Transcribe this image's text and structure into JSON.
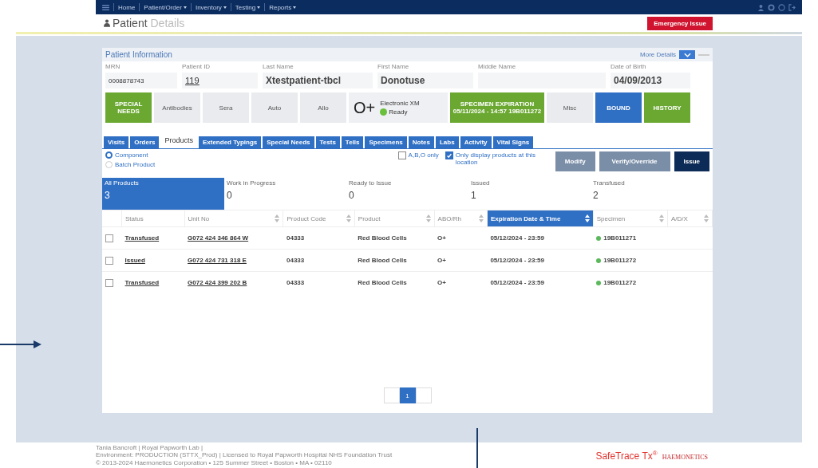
{
  "nav": {
    "items": [
      {
        "label": "Home",
        "dropdown": false
      },
      {
        "label": "Patient/Order",
        "dropdown": true
      },
      {
        "label": "Inventory",
        "dropdown": true
      },
      {
        "label": "Testing",
        "dropdown": true
      },
      {
        "label": "Reports",
        "dropdown": true
      }
    ]
  },
  "header": {
    "title_bold": "Patient",
    "title_light": "Details",
    "emergency_button": "Emergency Issue"
  },
  "patient": {
    "title": "Patient Information",
    "more_details": "More Details",
    "fields": [
      {
        "label": "MRN",
        "value": "0008878743",
        "kind": "text"
      },
      {
        "label": "Patient ID",
        "value": "119",
        "kind": "link"
      },
      {
        "label": "Last Name",
        "value": "Xtestpatient-tbcl",
        "kind": "big"
      },
      {
        "label": "First Name",
        "value": "Donotuse",
        "kind": "big"
      },
      {
        "label": "Middle Name",
        "kind": "empty"
      },
      {
        "label": "Date of Birth",
        "value": "04/09/2013",
        "kind": "big"
      }
    ],
    "buttons": [
      {
        "label": "SPECIAL NEEDS",
        "kind": "green"
      },
      {
        "label": "Antibodies",
        "kind": "grey"
      },
      {
        "label": "Sera",
        "kind": "grey"
      },
      {
        "label": "Auto",
        "kind": "grey"
      },
      {
        "label": "Allo",
        "kind": "grey"
      },
      {
        "label": "O+",
        "kind": "blood",
        "xm_label": "Electronic XM",
        "xm_status": "Ready"
      },
      {
        "label": "SPECIMEN EXPIRATION 05/11/2024 - 14:57 19B011272",
        "kind": "green"
      },
      {
        "label": "Misc",
        "kind": "grey"
      },
      {
        "label": "BOUND",
        "kind": "blue"
      },
      {
        "label": "HISTORY",
        "kind": "green"
      }
    ]
  },
  "tabs": [
    {
      "label": "Visits",
      "selected": false
    },
    {
      "label": "Orders",
      "selected": false
    },
    {
      "label": "Products",
      "selected": true
    },
    {
      "label": "Extended Typings",
      "selected": false
    },
    {
      "label": "Special Needs",
      "selected": false
    },
    {
      "label": "Tests",
      "selected": false
    },
    {
      "label": "Tells",
      "selected": false
    },
    {
      "label": "Specimens",
      "selected": false
    },
    {
      "label": "Notes",
      "selected": false
    },
    {
      "label": "Labs",
      "selected": false
    },
    {
      "label": "Activity",
      "selected": false
    },
    {
      "label": "Vital Signs",
      "selected": false
    }
  ],
  "product_type": [
    {
      "label": "Component",
      "selected": true
    },
    {
      "label": "Batch Product",
      "selected": false
    }
  ],
  "filters": [
    {
      "label": "A,B,O only",
      "checked": false
    },
    {
      "label": "Only display products at this location",
      "checked": true
    }
  ],
  "actions": [
    {
      "label": "Modify",
      "kind": "grey"
    },
    {
      "label": "Verify/Override",
      "kind": "grey"
    },
    {
      "label": "Issue",
      "kind": "dark"
    }
  ],
  "summary": [
    {
      "label": "All Products",
      "count": "3",
      "selected": true
    },
    {
      "label": "Work in Progress",
      "count": "0",
      "selected": false
    },
    {
      "label": "Ready to Issue",
      "count": "0",
      "selected": false
    },
    {
      "label": "Issued",
      "count": "1",
      "selected": false
    },
    {
      "label": "Transfused",
      "count": "2",
      "selected": false
    }
  ],
  "table": {
    "columns": [
      {
        "label": "Status",
        "sortable": false,
        "selected": false
      },
      {
        "label": "Unit No",
        "sortable": true,
        "selected": false
      },
      {
        "label": "Product Code",
        "sortable": true,
        "selected": false
      },
      {
        "label": "Product",
        "sortable": true,
        "selected": false
      },
      {
        "label": "ABO/Rh",
        "sortable": true,
        "selected": false
      },
      {
        "label": "Expiration Date & Time",
        "sortable": true,
        "selected": true
      },
      {
        "label": "Specimen",
        "sortable": true,
        "selected": false
      },
      {
        "label": "A/D/X",
        "sortable": true,
        "selected": false
      }
    ],
    "rows": [
      {
        "checked": false,
        "status": "Transfused",
        "unit": "G072 424 346 864 W",
        "code": "04333",
        "product": "Red Blood Cells",
        "abo": "O+",
        "expiration": "05/12/2024 - 23:59",
        "specimen": "19B011271",
        "color": "#5cb85c"
      },
      {
        "checked": false,
        "status": "Issued",
        "unit": "G072 424 731 318 E",
        "code": "04333",
        "product": "Red Blood Cells",
        "abo": "O+",
        "expiration": "05/12/2024 - 23:59",
        "specimen": "19B011272",
        "color": "#5cb85c"
      },
      {
        "checked": false,
        "status": "Transfused",
        "unit": "G072 424 399 202 B",
        "code": "04333",
        "product": "Red Blood Cells",
        "abo": "O+",
        "expiration": "05/12/2024 - 23:59",
        "specimen": "19B011272",
        "color": "#5cb85c"
      }
    ]
  },
  "pagination": [
    {
      "label": "1",
      "selected": true
    }
  ],
  "footer": {
    "lines": [
      "Tania Bancroft | Royal Papworth Lab |",
      "Environment: PRODUCTION (STTX_Prod) | Licensed to Royal Papworth Hospital NHS Foundation Trust",
      "© 2013-2024 Haemonetics Corporation • 125 Summer Street • Boston • MA • 02110"
    ],
    "product": "SafeTrace Tx",
    "product_sup": "®",
    "company": "HAEMONETICS"
  }
}
